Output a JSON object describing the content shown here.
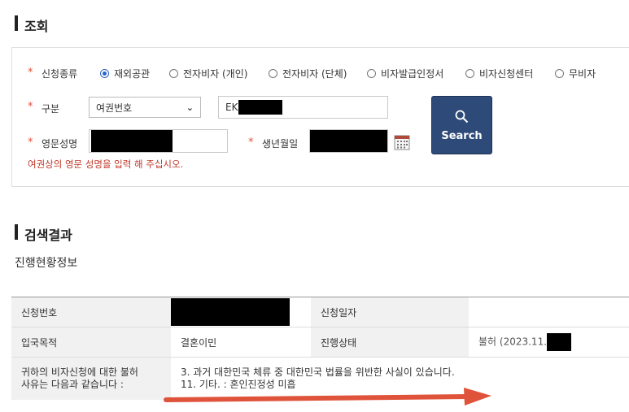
{
  "search_section": {
    "title": "조회",
    "application_type": {
      "label": "신청종류",
      "options": [
        "재외공관",
        "전자비자 (개인)",
        "전자비자 (단체)",
        "비자발급인정서",
        "비자신청센터",
        "무비자"
      ],
      "selected": "재외공관"
    },
    "category": {
      "label": "구분",
      "selected": "여권번호",
      "value_prefix": "EK"
    },
    "english_name": {
      "label": "영문성명"
    },
    "birth_date": {
      "label": "생년월일"
    },
    "hint": "여권상의 영문 성명을 입력 해 주십시오.",
    "search_button": "Search"
  },
  "results_section": {
    "title": "검색결과",
    "subtitle": "진행현황정보",
    "rows": {
      "application_number": {
        "label": "신청번호",
        "date_label": "신청일자"
      },
      "purpose": {
        "label": "입국목적",
        "value": "결혼이민",
        "status_label": "진행상태",
        "status_value": "불허 (2023.11."
      },
      "reason": {
        "label_line1": "귀하의 비자신청에 대한 불허",
        "label_line2": "사유는 다음과 같습니다 :",
        "value_line1": "3. 과거 대한민국 체류 중 대한민국 법률을 위반한 사실이 있습니다.",
        "value_line2": "11. 기타. : 혼인진정성 미흡"
      }
    }
  },
  "colors": {
    "accent": "#2e4a78",
    "required": "#e0533b",
    "hint": "#c0392b",
    "arrow": "#e0533b"
  }
}
